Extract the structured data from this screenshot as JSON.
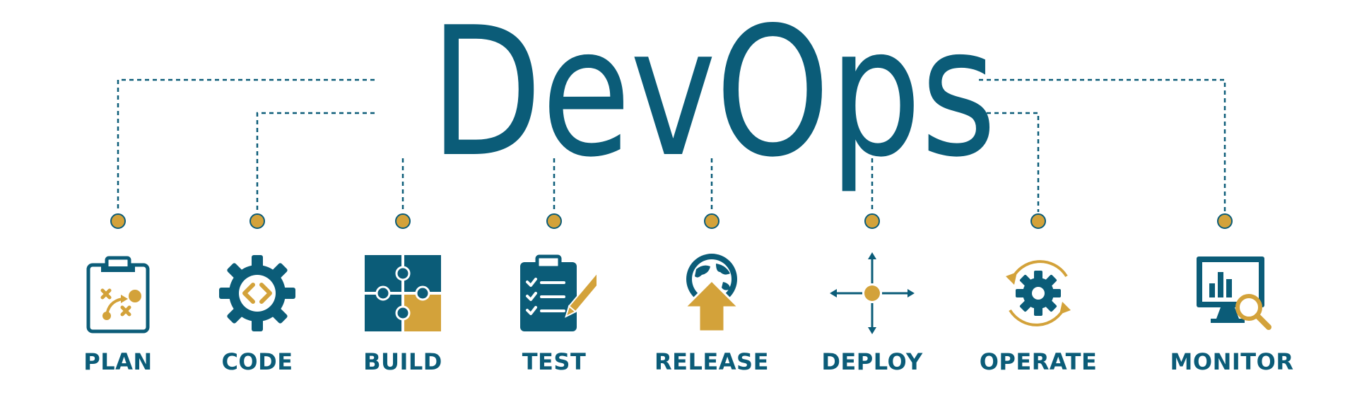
{
  "title": "DevOps",
  "colors": {
    "primary": "#0b5c78",
    "accent": "#d3a23a"
  },
  "stages": [
    {
      "label": "PLAN",
      "icon": "clipboard-plan-icon"
    },
    {
      "label": "CODE",
      "icon": "code-gear-icon"
    },
    {
      "label": "BUILD",
      "icon": "puzzle-icon"
    },
    {
      "label": "TEST",
      "icon": "checklist-icon"
    },
    {
      "label": "RELEASE",
      "icon": "globe-upload-icon"
    },
    {
      "label": "DEPLOY",
      "icon": "deploy-arrows-icon"
    },
    {
      "label": "OPERATE",
      "icon": "gear-cycle-icon"
    },
    {
      "label": "MONITOR",
      "icon": "monitor-search-icon"
    }
  ]
}
